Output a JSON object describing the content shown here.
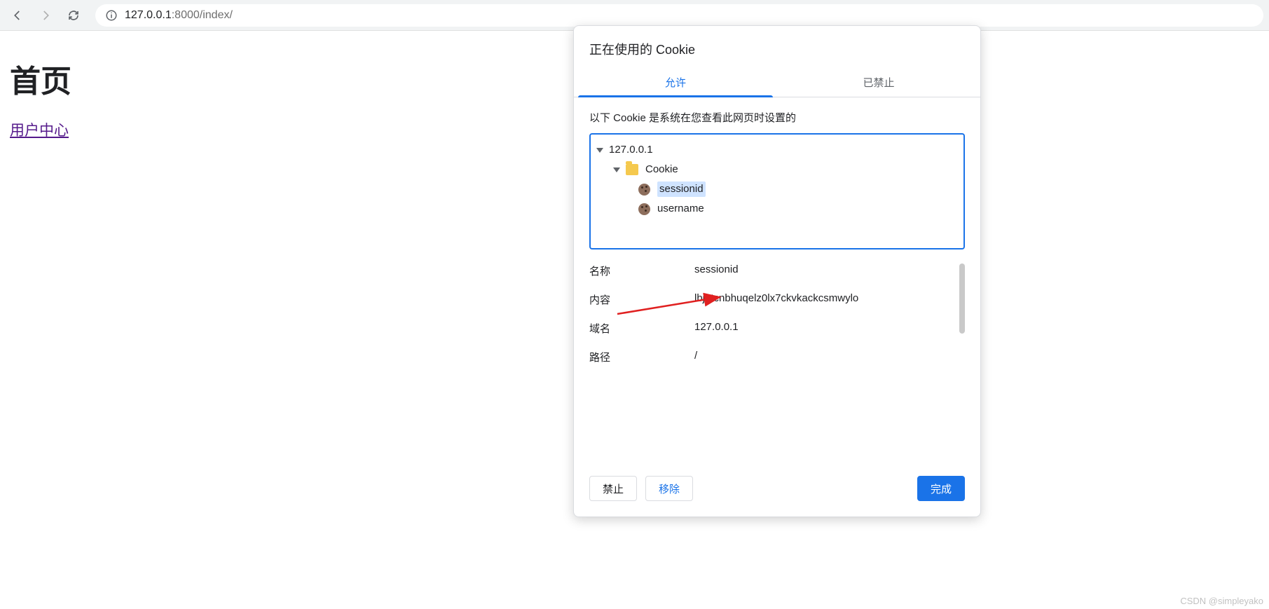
{
  "browser": {
    "url_host": "127.0.0.1",
    "url_port_path": ":8000/index/"
  },
  "page": {
    "heading": "首页",
    "user_center_link": "用户中心"
  },
  "dialog": {
    "title": "正在使用的 Cookie",
    "tabs": {
      "allow": "允许",
      "block": "已禁止"
    },
    "subtitle": "以下 Cookie 是系统在您查看此网页时设置的",
    "tree": {
      "host": "127.0.0.1",
      "folder": "Cookie",
      "cookies": [
        {
          "name": "sessionid",
          "selected": true
        },
        {
          "name": "username",
          "selected": false
        }
      ]
    },
    "details": {
      "name_label": "名称",
      "name_value": "sessionid",
      "content_label": "内容",
      "content_value": "lbjgtcnbhuqelz0lx7ckvkackcsmwylo",
      "domain_label": "域名",
      "domain_value": "127.0.0.1",
      "path_label": "路径",
      "path_value": "/"
    },
    "buttons": {
      "block": "禁止",
      "remove": "移除",
      "done": "完成"
    }
  },
  "watermark": "CSDN @simpleyako"
}
